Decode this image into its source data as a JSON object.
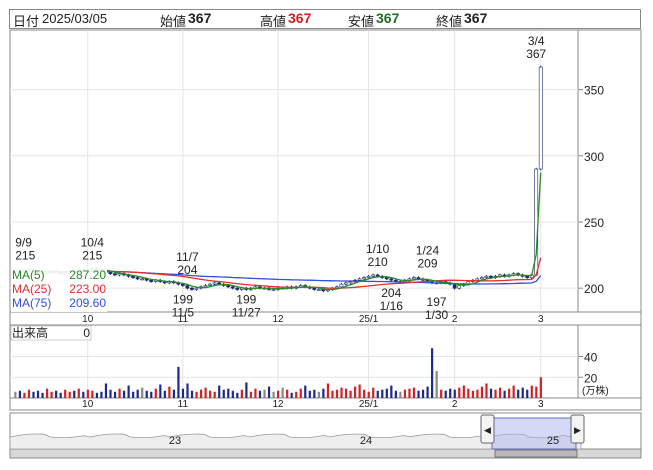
{
  "header": {
    "date_label": "日付",
    "date": "2025/03/05",
    "open_label": "始値",
    "open": "367",
    "high_label": "高値",
    "high": "367",
    "low_label": "安値",
    "low": "367",
    "close_label": "終値",
    "close": "367",
    "colors": {
      "open": "#222222",
      "high": "#d42020",
      "low": "#207020",
      "close": "#222222"
    }
  },
  "chart_data": [
    {
      "type": "line",
      "name": "price",
      "ylim": [
        182,
        395
      ],
      "y_ticks": [
        200,
        250,
        300,
        350
      ],
      "x_ticks": [
        {
          "label": "10",
          "index": 16
        },
        {
          "label": "11",
          "index": 37
        },
        {
          "label": "12",
          "index": 58
        },
        {
          "label": "25/1",
          "index": 78
        },
        {
          "label": "2",
          "index": 97
        },
        {
          "label": "3",
          "index": 116
        }
      ],
      "n_days": 117,
      "close": [
        213,
        212,
        213,
        214,
        213,
        212,
        211,
        212,
        213,
        212,
        211,
        212,
        213,
        212,
        214,
        213,
        214,
        215,
        214,
        213,
        212,
        211,
        210,
        211,
        210,
        209,
        208,
        207,
        207,
        206,
        205,
        206,
        205,
        204,
        205,
        204,
        203,
        202,
        200,
        199,
        200,
        201,
        202,
        203,
        204,
        203,
        202,
        201,
        200,
        199,
        200,
        199,
        200,
        201,
        200,
        200,
        199,
        199,
        200,
        200,
        201,
        200,
        201,
        202,
        201,
        200,
        199,
        199,
        198,
        199,
        200,
        201,
        203,
        204,
        205,
        206,
        207,
        208,
        209,
        210,
        209,
        208,
        207,
        206,
        205,
        205,
        206,
        207,
        208,
        207,
        206,
        205,
        204,
        204,
        205,
        204,
        203,
        200,
        202,
        203,
        205,
        206,
        207,
        208,
        209,
        208,
        209,
        210,
        209,
        210,
        211,
        210,
        209,
        208,
        210,
        290,
        367
      ],
      "ma5": [
        287.2,
        246,
        222,
        211
      ],
      "ma25": [
        223.0,
        212,
        207
      ],
      "ma75": [
        209.6,
        206,
        205
      ],
      "annotations": [
        {
          "text": "9/9",
          "index": 0,
          "value": 215,
          "pos": "above"
        },
        {
          "text": "215",
          "index": 0,
          "value": 215,
          "pos": "above2"
        },
        {
          "text": "10/4",
          "index": 17,
          "value": 215,
          "pos": "above"
        },
        {
          "text": "215",
          "index": 17,
          "value": 215,
          "pos": "above2"
        },
        {
          "text": "11/7",
          "index": 38,
          "value": 204,
          "pos": "above"
        },
        {
          "text": "204",
          "index": 38,
          "value": 204,
          "pos": "above2"
        },
        {
          "text": "199",
          "index": 37,
          "value": 199,
          "pos": "below"
        },
        {
          "text": "11/5",
          "index": 37,
          "value": 199,
          "pos": "below2"
        },
        {
          "text": "199",
          "index": 51,
          "value": 199,
          "pos": "below"
        },
        {
          "text": "11/27",
          "index": 51,
          "value": 199,
          "pos": "below2"
        },
        {
          "text": "1/10",
          "index": 80,
          "value": 210,
          "pos": "above"
        },
        {
          "text": "210",
          "index": 80,
          "value": 210,
          "pos": "above2"
        },
        {
          "text": "1/24",
          "index": 91,
          "value": 209,
          "pos": "above"
        },
        {
          "text": "209",
          "index": 91,
          "value": 209,
          "pos": "above2"
        },
        {
          "text": "204",
          "index": 83,
          "value": 204,
          "pos": "below"
        },
        {
          "text": "1/16",
          "index": 83,
          "value": 204,
          "pos": "below2"
        },
        {
          "text": "197",
          "index": 93,
          "value": 197,
          "pos": "below"
        },
        {
          "text": "1/30",
          "index": 93,
          "value": 197,
          "pos": "below2"
        },
        {
          "text": "3/4",
          "index": 115,
          "value": 367,
          "pos": "above"
        },
        {
          "text": "367",
          "index": 115,
          "value": 367,
          "pos": "above2"
        }
      ],
      "legend": [
        {
          "label": "MA(5)",
          "value": "287.20",
          "color": "#2a8a2a"
        },
        {
          "label": "MA(25)",
          "value": "223.00",
          "color": "#e03030"
        },
        {
          "label": "MA(75)",
          "value": "209.60",
          "color": "#3050e0"
        }
      ],
      "colors": {
        "ma5": "#2a8a2a",
        "ma25": "#e03030",
        "ma75": "#3050e0",
        "up": "#ffffff",
        "down": "#1a2a6a"
      }
    },
    {
      "type": "bar",
      "name": "volume",
      "label": "出来高",
      "current": "0",
      "unit": "(万株)",
      "ylim": [
        0,
        54
      ],
      "y_ticks": [
        20,
        40
      ],
      "values": [
        6,
        7,
        5,
        8,
        6,
        7,
        5,
        9,
        6,
        7,
        5,
        8,
        6,
        7,
        9,
        6,
        8,
        7,
        5,
        6,
        14,
        8,
        6,
        9,
        7,
        12,
        6,
        8,
        10,
        7,
        6,
        9,
        13,
        7,
        11,
        8,
        30,
        9,
        14,
        7,
        6,
        8,
        10,
        7,
        6,
        12,
        8,
        9,
        7,
        5,
        8,
        15,
        6,
        9,
        7,
        8,
        11,
        6,
        7,
        10,
        8,
        5,
        6,
        9,
        12,
        7,
        8,
        6,
        9,
        14,
        7,
        8,
        10,
        9,
        7,
        11,
        13,
        8,
        6,
        10,
        7,
        8,
        9,
        12,
        7,
        6,
        8,
        9,
        10,
        7,
        8,
        11,
        48,
        26,
        8,
        7,
        9,
        8,
        10,
        12,
        9,
        7,
        8,
        11,
        14,
        9,
        8,
        10,
        7,
        9,
        12,
        8,
        10,
        8,
        12,
        11,
        20
      ],
      "colors": {
        "up": "#d42020",
        "down": "#1a2a8a",
        "flat": "#888888"
      }
    },
    {
      "type": "area",
      "name": "navigator",
      "x_labels": [
        "23",
        "24",
        "25"
      ]
    }
  ]
}
